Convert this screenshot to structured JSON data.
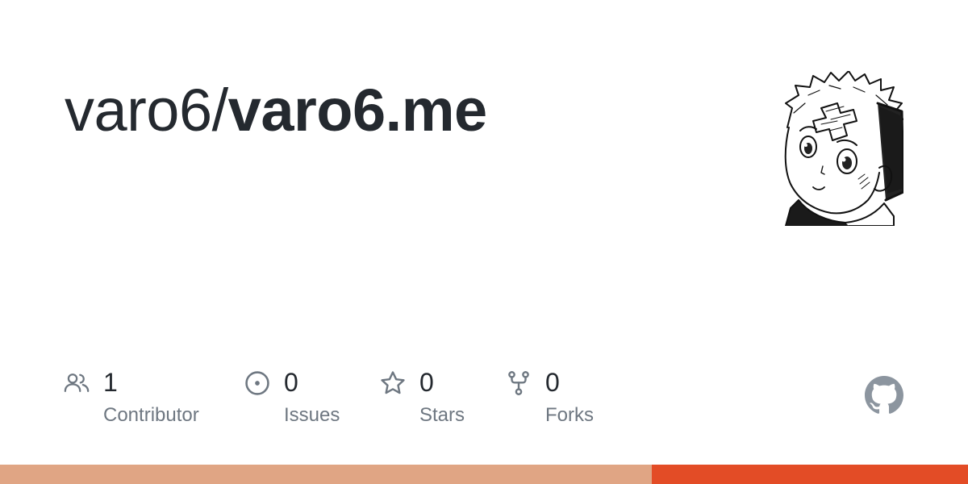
{
  "repo": {
    "owner": "varo6/",
    "name": "varo6.me"
  },
  "stats": [
    {
      "icon": "people-icon",
      "count": "1",
      "label": "Contributor"
    },
    {
      "icon": "issue-icon",
      "count": "0",
      "label": "Issues"
    },
    {
      "icon": "star-icon",
      "count": "0",
      "label": "Stars"
    },
    {
      "icon": "fork-icon",
      "count": "0",
      "label": "Forks"
    }
  ],
  "colors": {
    "text": "#24292f",
    "muted": "#6e7781",
    "icon": "#6e7781",
    "lang_primary": "#e0a584",
    "lang_secondary": "#e34c26"
  },
  "language_bar": [
    {
      "color": "#e0a584",
      "fraction": 0.673
    },
    {
      "color": "#e34c26",
      "fraction": 0.327
    }
  ]
}
